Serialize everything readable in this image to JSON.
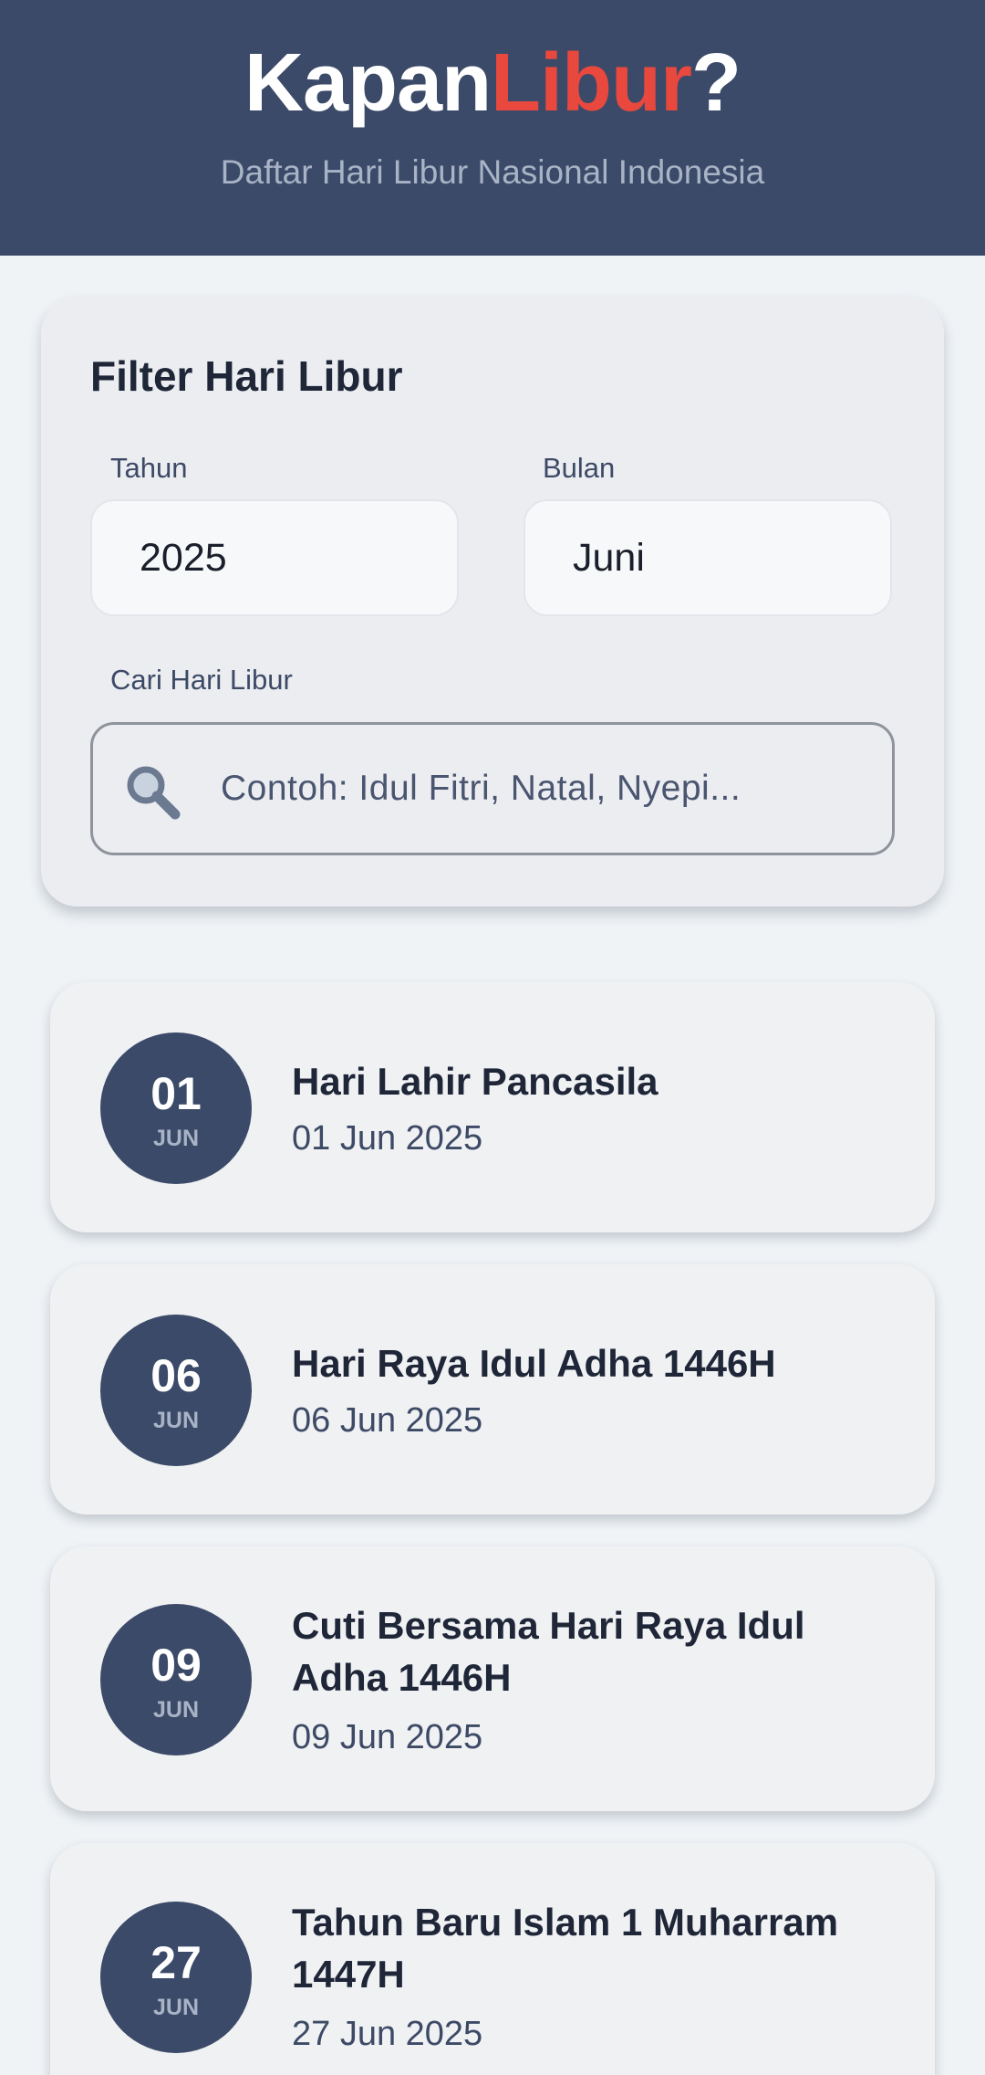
{
  "header": {
    "title_part1": "Kapan",
    "title_part2": "Libur",
    "title_part3": "?",
    "subtitle": "Daftar Hari Libur Nasional Indonesia",
    "accent_color": "#e8483d",
    "background_color": "#3b4a68"
  },
  "filter": {
    "title": "Filter Hari Libur",
    "year_label": "Tahun",
    "year_value": "2025",
    "month_label": "Bulan",
    "month_value": "Juni",
    "search_label": "Cari Hari Libur",
    "search_placeholder": "Contoh: Idul Fitri, Natal, Nyepi...",
    "search_icon": "search-icon"
  },
  "holidays": [
    {
      "day": "01",
      "month": "JUN",
      "name": "Hari Lahir Pancasila",
      "date": "01 Jun 2025"
    },
    {
      "day": "06",
      "month": "JUN",
      "name": "Hari Raya Idul Adha 1446H",
      "date": "06 Jun 2025"
    },
    {
      "day": "09",
      "month": "JUN",
      "name": "Cuti Bersama Hari Raya Idul Adha 1446H",
      "date": "09 Jun 2025"
    },
    {
      "day": "27",
      "month": "JUN",
      "name": "Tahun Baru Islam 1 Muharram 1447H",
      "date": "27 Jun 2025"
    }
  ]
}
